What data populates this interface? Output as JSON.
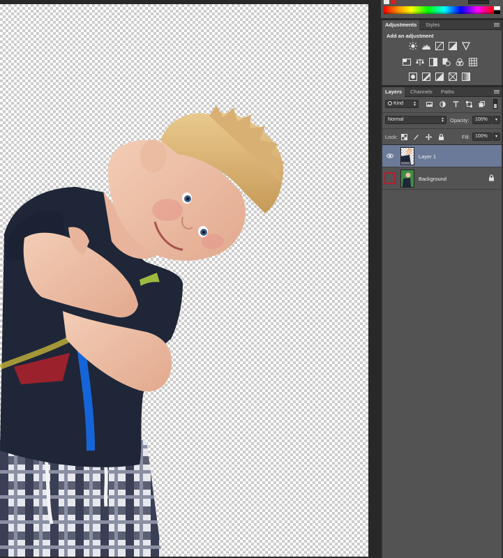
{
  "canvas": {
    "name": "transparent-canvas"
  },
  "adjustments_panel": {
    "tabs": [
      {
        "label": "Adjustments",
        "active": true
      },
      {
        "label": "Styles",
        "active": false
      }
    ],
    "title": "Add an adjustment",
    "icons_row1": [
      "brightness-contrast-icon",
      "levels-icon",
      "curves-icon",
      "exposure-icon",
      "gradient-triangle-icon"
    ],
    "icons_row2": [
      "vibrance-icon",
      "color-balance-icon",
      "black-white-icon",
      "photo-filter-icon",
      "channel-mixer-icon",
      "color-lookup-icon"
    ],
    "icons_row3": [
      "invert-icon",
      "posterize-icon",
      "threshold-icon",
      "selective-color-icon",
      "gradient-map-icon"
    ]
  },
  "layers_panel": {
    "tabs": [
      {
        "label": "Layers",
        "active": true
      },
      {
        "label": "Channels",
        "active": false
      },
      {
        "label": "Paths",
        "active": false
      }
    ],
    "filter": {
      "kind_label": "Kind"
    },
    "blend_mode": "Normal",
    "opacity_label": "Opacity:",
    "opacity_value": "100%",
    "lock_label": "Lock:",
    "fill_label": "Fill:",
    "fill_value": "100%",
    "layers": [
      {
        "name": "Layer 1",
        "selected": true,
        "visible": true,
        "locked": false
      },
      {
        "name": "Background",
        "selected": false,
        "visible": false,
        "locked": true
      }
    ]
  },
  "colors": {
    "selection_highlight": "#6b7a98",
    "visibility_box_outline": "#b71c2c",
    "panel_bg": "#535353"
  }
}
